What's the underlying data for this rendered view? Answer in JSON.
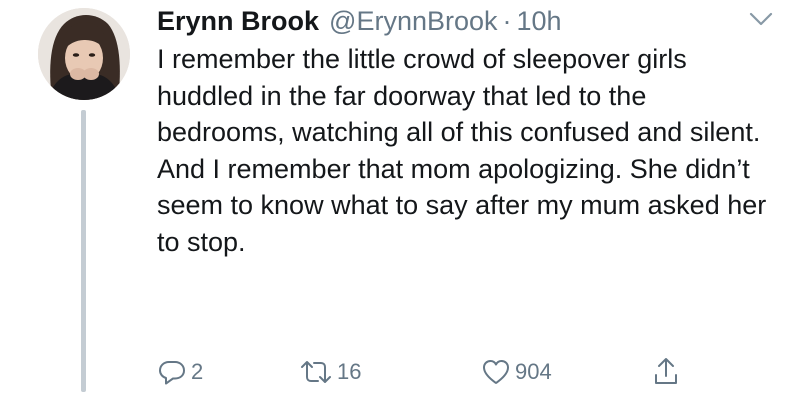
{
  "tweet": {
    "author": {
      "display_name": "Erynn Brook",
      "handle": "@ErynnBrook",
      "separator": "·",
      "timestamp": "10h"
    },
    "text": "I remember the little crowd of sleepover girls huddled in the far doorway that led to the bedrooms, watching all of this confused and silent. And I remember that mom apologizing. She didn’t seem to know what to say after my mum asked her to stop.",
    "actions": {
      "reply": {
        "icon": "reply-icon",
        "count": "2"
      },
      "retweet": {
        "icon": "retweet-icon",
        "count": "16"
      },
      "like": {
        "icon": "heart-icon",
        "count": "904"
      },
      "share": {
        "icon": "share-icon"
      }
    },
    "menu_icon": "chevron-down-icon",
    "colors": {
      "text": "#14171a",
      "muted": "#657786",
      "thread_line": "#c4ccd3",
      "background": "#ffffff"
    }
  }
}
